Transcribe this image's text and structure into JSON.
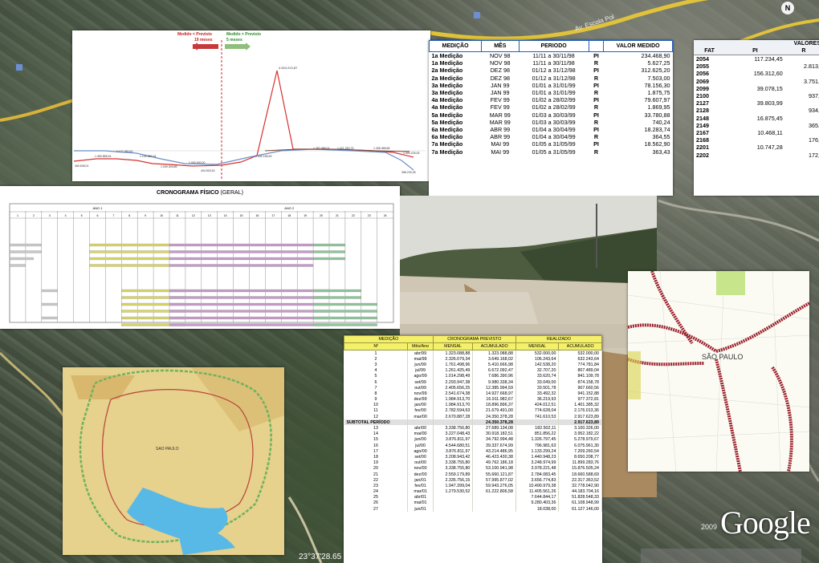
{
  "map": {
    "coordinates": "23°37'28.65",
    "copyright_year": "2009",
    "logo": "Google",
    "compass": "N",
    "road_label": "Av. Escola Pol",
    "compass_icon": "compass-icon"
  },
  "chart": {
    "legend_left": "Medido < Previsto",
    "legend_left_sub": "19 meses",
    "legend_right": "Medido > Previsto",
    "legend_right_sub": "5 meses",
    "peak_label": "4.503.222,87",
    "left_labels": [
      "460.848,01",
      "1.369.858,34",
      "1.177.380,60",
      "1.100.380,34",
      "1.039.305,86",
      "1.000.000,00",
      "404.500,52"
    ],
    "right_labels": [
      "1.332.185,53",
      "1.357.085,07",
      "1.421.283,75",
      "1.308.388,68",
      "368.230,35",
      "1.303.225,05"
    ],
    "red_line_color": "#d83030",
    "blue_line_color": "#6a8fc8",
    "brown_line_color": "#7a4a30"
  },
  "medicao": {
    "headers": [
      "MEDIÇÃO",
      "MÊS",
      "PERIODO",
      "",
      "VALOR MEDIDO"
    ],
    "rows": [
      [
        "1a Medição",
        "NOV 98",
        "11/11 a 30/11/98",
        "PI",
        "234.468,90"
      ],
      [
        "1a Medição",
        "NOV 98",
        "11/11 a 30/11/98",
        "R",
        "5.627,25"
      ],
      [
        "2a Medição",
        "DEZ 98",
        "01/12 a 31/12/98",
        "PI",
        "312.625,20"
      ],
      [
        "2a Medição",
        "DEZ 98",
        "01/12 a 31/12/98",
        "R",
        "7.503,00"
      ],
      [
        "3a Medição",
        "JAN 99",
        "01/01 a 31/01/99",
        "PI",
        "78.156,30"
      ],
      [
        "3a Medição",
        "JAN 99",
        "01/01 a 31/01/99",
        "R",
        "1.875,75"
      ],
      [
        "4a Medição",
        "FEV 99",
        "01/02 a 28/02/99",
        "PI",
        "79.607,97"
      ],
      [
        "4a Medição",
        "FEV 99",
        "01/02 a 28/02/99",
        "R",
        "1.869,95"
      ],
      [
        "5a Medição",
        "MAR 99",
        "01/03 a 30/03/99",
        "PI",
        "33.780,88"
      ],
      [
        "5a Medição",
        "MAR 99",
        "01/03 a 30/03/99",
        "R",
        "740,24"
      ],
      [
        "6a Medição",
        "ABR 99",
        "01/04 a 30/04/99",
        "PI",
        "18.283,74"
      ],
      [
        "6a Medição",
        "ABR 99",
        "01/04 a 30/04/99",
        "R",
        "364,55"
      ],
      [
        "7a Medição",
        "MAI 99",
        "01/05 a 31/05/99",
        "PI",
        "18.562,90"
      ],
      [
        "7a Medição",
        "MAI 99",
        "01/05 a 31/05/99",
        "R",
        "363,43"
      ]
    ]
  },
  "valores": {
    "title": "VALORES",
    "headers": [
      "FAT",
      "PI",
      "R"
    ],
    "rows": [
      [
        "2054",
        "117.234,45",
        ""
      ],
      [
        "2055",
        "",
        "2.813,"
      ],
      [
        "2056",
        "156.312,60",
        ""
      ],
      [
        "2069",
        "",
        "3.751,"
      ],
      [
        "2099",
        "39.078,15",
        ""
      ],
      [
        "2100",
        "",
        "937,"
      ],
      [
        "2127",
        "39.803,99",
        ""
      ],
      [
        "2128",
        "",
        "934,"
      ],
      [
        "2148",
        "16.875,45",
        ""
      ],
      [
        "2149",
        "",
        "365,"
      ],
      [
        "2167",
        "10.468,11",
        ""
      ],
      [
        "2168",
        "",
        "176,"
      ],
      [
        "2201",
        "10.747,28",
        ""
      ],
      [
        "2202",
        "",
        "172,"
      ]
    ]
  },
  "gantt": {
    "title": "CRONOGRAMA FÍSICO",
    "title_suffix": "(GERAL)",
    "year1": "ANO 1",
    "year2": "ANO 2",
    "months": [
      "1",
      "2",
      "3",
      "4",
      "5",
      "6",
      "7",
      "8",
      "9",
      "10",
      "11",
      "12",
      "13",
      "14",
      "15",
      "16",
      "17",
      "18",
      "19",
      "20",
      "21",
      "22",
      "23",
      "24"
    ]
  },
  "crono": {
    "head_med": "MEDIÇÃO",
    "head_prev": "CRONOGRAMA PREVISTO",
    "head_real": "REALIZADO",
    "sub": [
      "Nº",
      "Mês/Ano",
      "MENSAL",
      "ACUMULADO",
      "MENSAL",
      "ACUMULADO"
    ],
    "rows1": [
      [
        "1",
        "abr/99",
        "1.323.088,88",
        "1.323.088,88",
        "532.000,00",
        "532.000,00"
      ],
      [
        "2",
        "mai/99",
        "2.326.079,34",
        "3.649.168,02",
        "106.243,64",
        "632.243,64"
      ],
      [
        "3",
        "jun/99",
        "1.761.498,96",
        "5.410.666,98",
        "142.538,20",
        "774.781,84"
      ],
      [
        "4",
        "jul/99",
        "1.261.425,49",
        "6.672.092,47",
        "32.707,20",
        "807.489,04"
      ],
      [
        "5",
        "ago/99",
        "1.014.298,49",
        "7.686.390,96",
        "33.620,74",
        "841.109,78"
      ],
      [
        "6",
        "set/99",
        "2.293.947,38",
        "9.980.338,34",
        "33.049,00",
        "874.158,78"
      ],
      [
        "7",
        "out/99",
        "2.405.656,25",
        "12.385.994,59",
        "33.501,78",
        "907.660,56"
      ],
      [
        "8",
        "nov/99",
        "2.541.674,38",
        "14.927.668,97",
        "33.492,32",
        "941.152,88"
      ],
      [
        "9",
        "dez/99",
        "1.984.913,70",
        "16.911.982,67",
        "36.219,93",
        "977.372,81"
      ],
      [
        "10",
        "jan/00",
        "1.984.913,70",
        "18.896.896,37",
        "424.012,51",
        "1.401.385,32"
      ],
      [
        "11",
        "fev/00",
        "2.782.594,63",
        "21.679.491,00",
        "774.628,04",
        "2.176.013,36"
      ],
      [
        "12",
        "mar/00",
        "2.670.887,28",
        "24.350.378,28",
        "741.610,53",
        "2.917.623,89"
      ]
    ],
    "subtotal": [
      "SUBTOTAL PERÍODO",
      "",
      "",
      "24.350.378,28",
      "",
      "2.917.623,89"
    ],
    "rows2": [
      [
        "13",
        "abr/00",
        "3.338.756,80",
        "27.689.134,08",
        "182.502,11",
        "3.100.326,00"
      ],
      [
        "14",
        "mai/00",
        "3.227.048,43",
        "30.918.182,51",
        "851.856,22",
        "3.952.182,22"
      ],
      [
        "15",
        "jun/00",
        "3.876.811,97",
        "34.792.994,48",
        "1.326.797,45",
        "5.278.979,67"
      ],
      [
        "16",
        "jul/00",
        "4.544.680,51",
        "39.337.674,99",
        "796.981,63",
        "6.075.961,30"
      ],
      [
        "17",
        "ago/00",
        "3.876.811,97",
        "43.214.486,95",
        "1.133.299,24",
        "7.209.260,54"
      ],
      [
        "18",
        "set/00",
        "3.208.943,42",
        "46.423.430,38",
        "1.440.948,23",
        "8.650.208,77"
      ],
      [
        "19",
        "out/00",
        "3.338.755,80",
        "49.762.186,18",
        "3.248.974,99",
        "11.899.283,76"
      ],
      [
        "20",
        "nov/00",
        "3.338.755,80",
        "53.100.941,98",
        "3.978.221,48",
        "15.876.505,24"
      ],
      [
        "21",
        "dez/00",
        "2.559.179,89",
        "55.660.121,87",
        "2.784.083,45",
        "18.660.588,69"
      ],
      [
        "22",
        "jan/01",
        "2.335.756,15",
        "57.995.877,02",
        "3.656.774,83",
        "22.317.363,52"
      ],
      [
        "23",
        "fev/01",
        "1.947.399,04",
        "59.943.276,05",
        "10.490.979,38",
        "32.778.042,90"
      ],
      [
        "24",
        "mar/01",
        "1.279.530,52",
        "61.222.806,58",
        "11.405.561,26",
        "44.183.704,16"
      ],
      [
        "25",
        "abr/01",
        "",
        "",
        "7.644.844,17",
        "51.828.548,33"
      ],
      [
        "26",
        "mai/01",
        "",
        "",
        "9.280.403,36",
        "61.108.948,99"
      ],
      [
        "27",
        "jun/01",
        "",
        "",
        "18.038,00",
        "61.127.146,00"
      ]
    ]
  },
  "map1": {
    "label": "SAO PAULO",
    "ring_color": "#6fb35e",
    "water_color": "#58b9e6"
  },
  "map2": {
    "label": "SÃO PAULO",
    "road_color": "#9a1f2a"
  }
}
